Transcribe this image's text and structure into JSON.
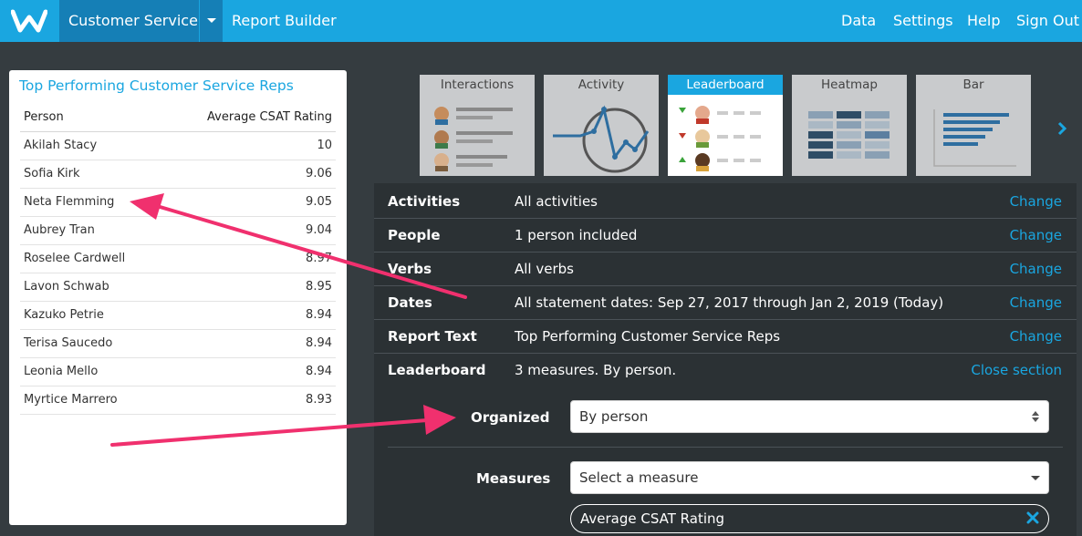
{
  "topbar": {
    "app_name": "Customer Service",
    "report_builder": "Report Builder",
    "nav": [
      "Data",
      "Settings",
      "Help",
      "Sign Out"
    ]
  },
  "leaderboard_card": {
    "title": "Top Performing Customer Service Reps",
    "columns": [
      "Person",
      "Average CSAT Rating"
    ],
    "rows": [
      {
        "person": "Akilah Stacy",
        "rating": "10"
      },
      {
        "person": "Sofia Kirk",
        "rating": "9.06"
      },
      {
        "person": "Neta Flemming",
        "rating": "9.05"
      },
      {
        "person": "Aubrey Tran",
        "rating": "9.04"
      },
      {
        "person": "Roselee Cardwell",
        "rating": "8.97"
      },
      {
        "person": "Lavon Schwab",
        "rating": "8.95"
      },
      {
        "person": "Kazuko Petrie",
        "rating": "8.94"
      },
      {
        "person": "Terisa Saucedo",
        "rating": "8.94"
      },
      {
        "person": "Leonia Mello",
        "rating": "8.94"
      },
      {
        "person": "Myrtice Marrero",
        "rating": "8.93"
      }
    ]
  },
  "report_types": [
    {
      "label": "Interactions",
      "active": false
    },
    {
      "label": "Activity",
      "active": false
    },
    {
      "label": "Leaderboard",
      "active": true
    },
    {
      "label": "Heatmap",
      "active": false
    },
    {
      "label": "Bar",
      "active": false
    }
  ],
  "settings": [
    {
      "label": "Activities",
      "value": "All activities",
      "action": "Change"
    },
    {
      "label": "People",
      "value": "1 person included",
      "action": "Change"
    },
    {
      "label": "Verbs",
      "value": "All verbs",
      "action": "Change"
    },
    {
      "label": "Dates",
      "value": "All statement dates: Sep 27, 2017 through Jan 2, 2019 (Today)",
      "action": "Change"
    },
    {
      "label": "Report Text",
      "value": "Top Performing Customer Service Reps",
      "action": "Change"
    },
    {
      "label": "Leaderboard",
      "value": "3 measures. By person.",
      "action": "Close section"
    }
  ],
  "leaderboard_section": {
    "organized_label": "Organized",
    "organized_value": "By person",
    "measures_label": "Measures",
    "measures_placeholder": "Select a measure",
    "selected_measure": "Average CSAT Rating"
  },
  "colors": {
    "brand": "#1aa6e0",
    "brand_dark": "#157fb6",
    "panel": "#2b3134",
    "background": "#353c40",
    "annotation_arrow": "#f0306e"
  }
}
